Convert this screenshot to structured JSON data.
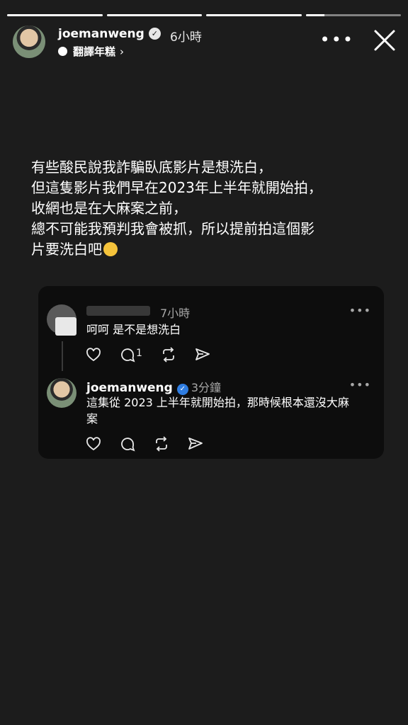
{
  "progress": [
    1,
    1,
    1,
    0.2
  ],
  "header": {
    "username": "joemanweng",
    "time": "6小時",
    "translate_label": "翻譯年糕",
    "more_label": "•••"
  },
  "caption": {
    "text": "有些酸民說我詐騙臥底影片是想洗白，\n但這隻影片我們早在2023年上半年就開始拍，\n收網也是在大麻案之前，\n總不可能我預判我會被抓，所以提前拍這個影\n片要洗白吧"
  },
  "comment": {
    "time": "7小時",
    "text": "呵呵 是不是想洗白",
    "reply_count": "1",
    "more_label": "•••"
  },
  "reply": {
    "username": "joemanweng",
    "time": "3分鐘",
    "text": "這集從 2023 上半年就開始拍，那時候根本還沒大麻\n案",
    "more_label": "•••"
  },
  "colors": {
    "background": "#1c1c1c",
    "card": "#0d0d0d",
    "verified_blue": "#2f7de1",
    "secondary_text": "#a8a8a8"
  }
}
